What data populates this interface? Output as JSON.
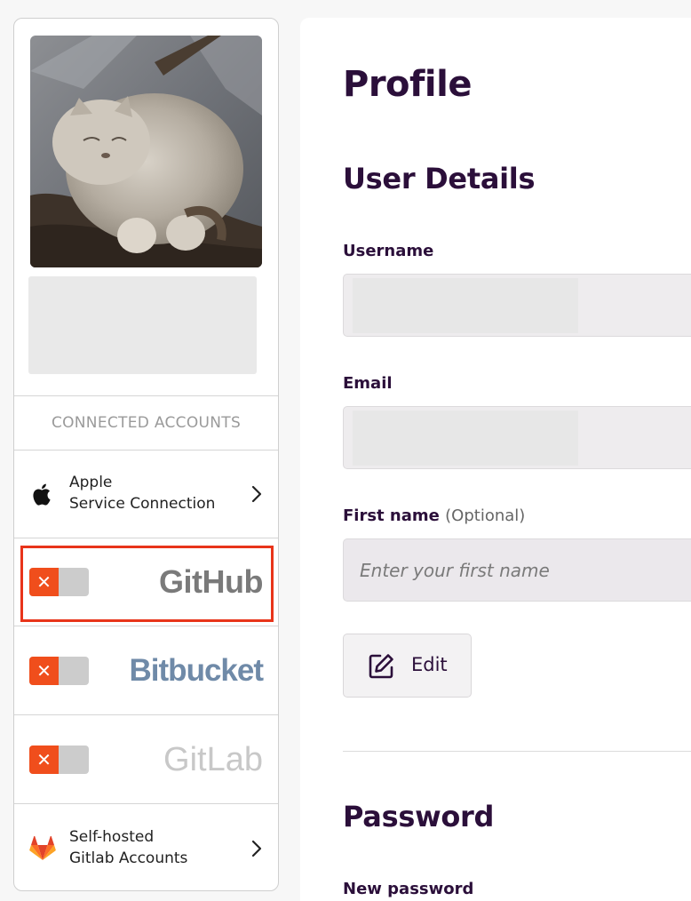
{
  "sidebar": {
    "connected_heading": "CONNECTED ACCOUNTS",
    "accounts": [
      {
        "line1": "Apple",
        "line2": "Service Connection",
        "icon": "apple-icon"
      },
      {
        "brand": "GitHub",
        "connected": false,
        "highlighted": true
      },
      {
        "brand": "Bitbucket",
        "connected": false
      },
      {
        "brand": "GitLab",
        "connected": false
      },
      {
        "line1": "Self-hosted",
        "line2": "Gitlab Accounts",
        "icon": "gitlab-fox-icon"
      }
    ],
    "toggle_off_glyph": "✕"
  },
  "main": {
    "title": "Profile",
    "user_details_heading": "User Details",
    "username_label": "Username",
    "email_label": "Email",
    "first_name_label": "First name",
    "first_name_optional": "(Optional)",
    "first_name_placeholder": "Enter your first name",
    "edit_button": "Edit",
    "password_heading": "Password",
    "new_password_label": "New password"
  },
  "colors": {
    "heading": "#2b0f3a",
    "toggle_off": "#f04e1c",
    "highlight": "#e8341a"
  }
}
